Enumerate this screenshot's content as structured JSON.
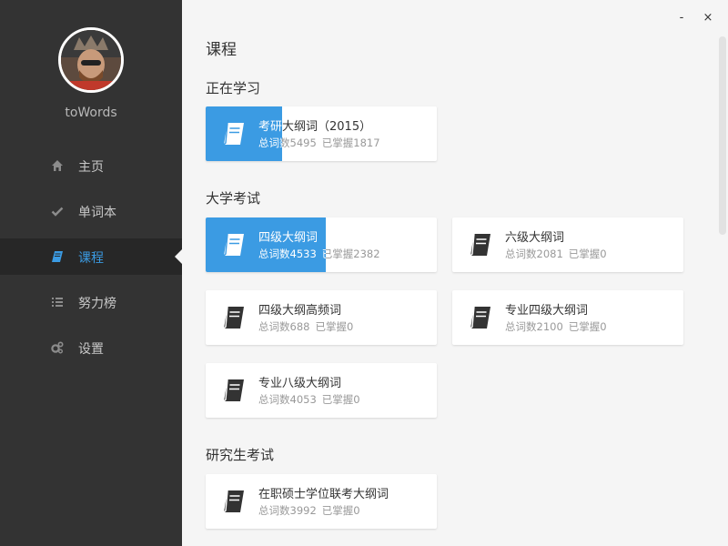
{
  "sidebar": {
    "username": "toWords",
    "items": [
      {
        "label": "主页",
        "icon": "home-icon"
      },
      {
        "label": "单词本",
        "icon": "check-icon"
      },
      {
        "label": "课程",
        "icon": "book-icon"
      },
      {
        "label": "努力榜",
        "icon": "list-icon"
      },
      {
        "label": "设置",
        "icon": "gears-icon"
      }
    ],
    "active_index": 2
  },
  "window": {
    "minimize_label": "-",
    "close_label": "×"
  },
  "main": {
    "page_title": "课程",
    "sections": [
      {
        "title": "正在学习",
        "courses": [
          {
            "name": "考研大纲词（2015）",
            "total": "总词数5495",
            "mastered": "已掌握1817",
            "progress": 0.33
          }
        ]
      },
      {
        "title": "大学考试",
        "courses": [
          {
            "name": "四级大纲词",
            "total": "总词数4533",
            "mastered": "已掌握2382",
            "progress": 0.52
          },
          {
            "name": "六级大纲词",
            "total": "总词数2081",
            "mastered": "已掌握0",
            "progress": 0
          },
          {
            "name": "四级大纲高频词",
            "total": "总词数688",
            "mastered": "已掌握0",
            "progress": 0
          },
          {
            "name": "专业四级大纲词",
            "total": "总词数2100",
            "mastered": "已掌握0",
            "progress": 0
          },
          {
            "name": "专业八级大纲词",
            "total": "总词数4053",
            "mastered": "已掌握0",
            "progress": 0
          }
        ]
      },
      {
        "title": "研究生考试",
        "courses": [
          {
            "name": "在职硕士学位联考大纲词",
            "total": "总词数3992",
            "mastered": "已掌握0",
            "progress": 0
          }
        ]
      }
    ]
  },
  "colors": {
    "accent": "#3b9be3",
    "sidebar_bg": "#333333",
    "main_bg": "#f5f5f5"
  }
}
